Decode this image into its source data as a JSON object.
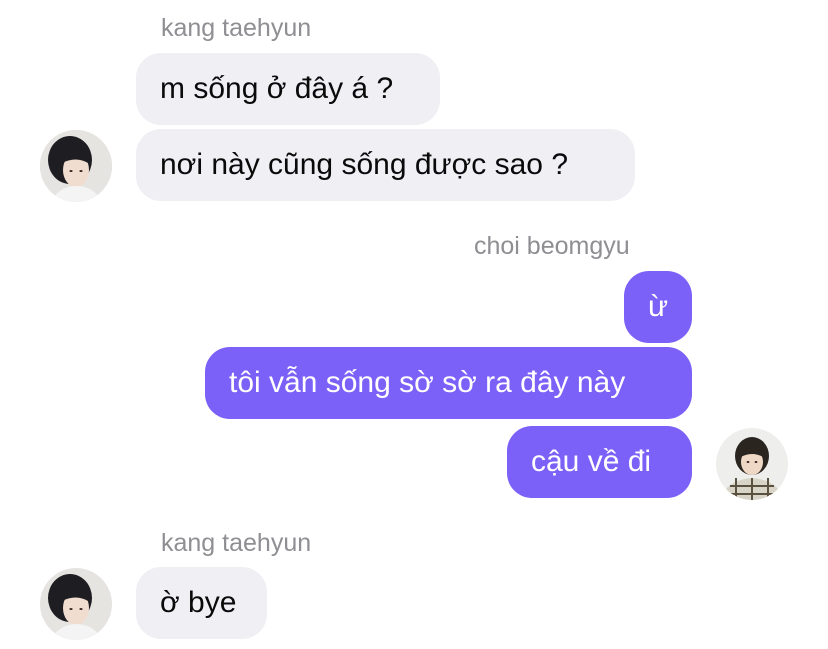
{
  "conversation": {
    "messages": [
      {
        "sender": "kang taehyun",
        "direction": "incoming",
        "text": "m sống ở đây á ?"
      },
      {
        "sender": "kang taehyun",
        "direction": "incoming",
        "text": "nơi này cũng sống được sao ?"
      },
      {
        "sender": "choi beomgyu",
        "direction": "outgoing",
        "text": "ừ"
      },
      {
        "sender": "choi beomgyu",
        "direction": "outgoing",
        "text": "tôi vẫn sống sờ sờ ra đây này"
      },
      {
        "sender": "choi beomgyu",
        "direction": "outgoing",
        "text": "cậu về đi"
      },
      {
        "sender": "kang taehyun",
        "direction": "incoming",
        "text": "ờ bye"
      }
    ]
  },
  "colors": {
    "incoming_bubble": "#efeff4",
    "outgoing_bubble": "#7b61f8",
    "sender_name": "#8e8e93"
  },
  "icons": {
    "taehyun_avatar": "avatar-photo-icon",
    "beomgyu_avatar": "avatar-photo-icon"
  }
}
